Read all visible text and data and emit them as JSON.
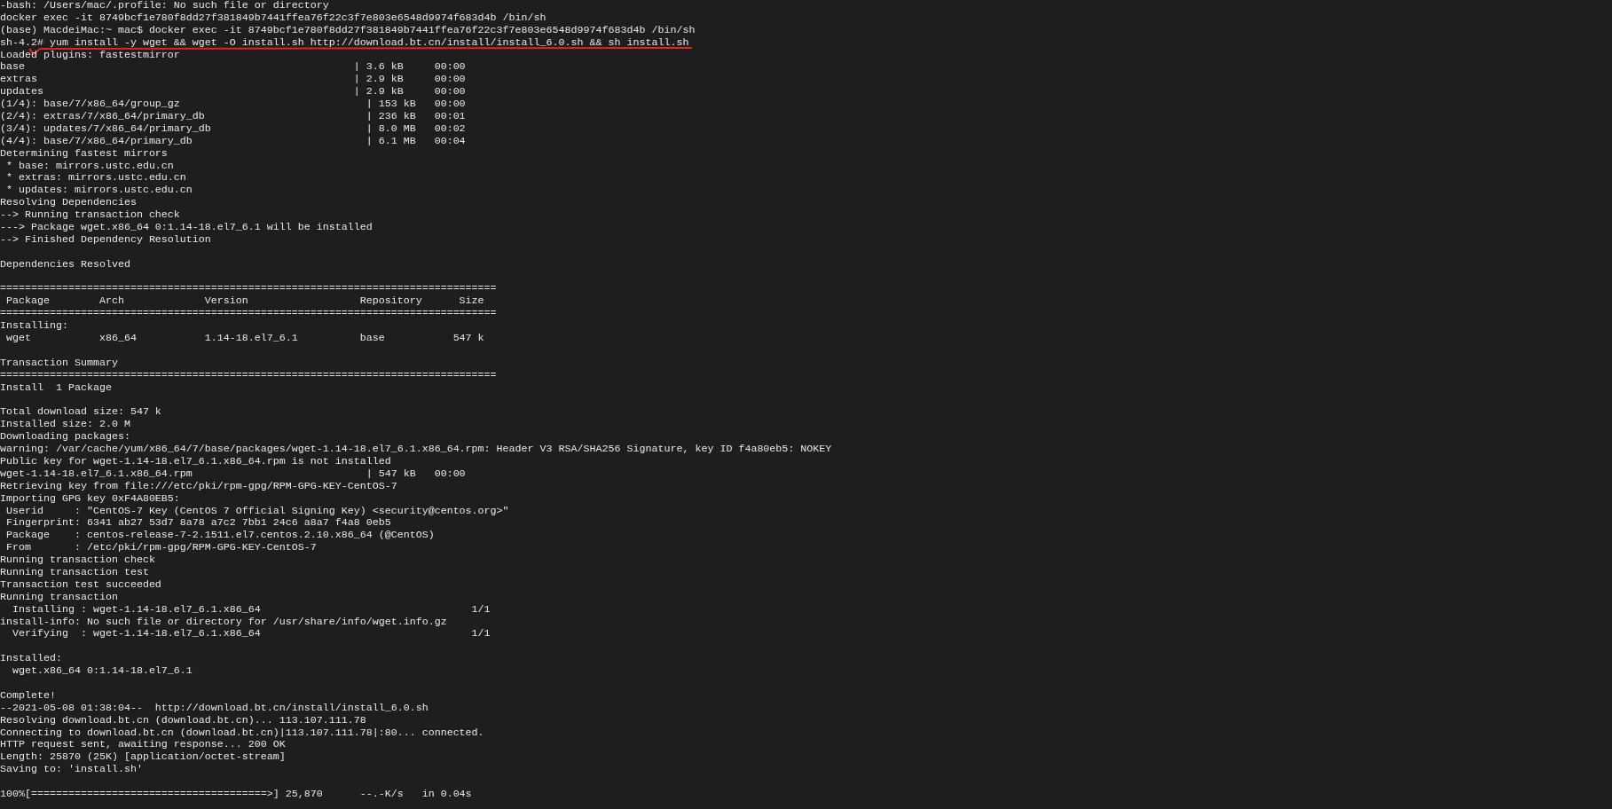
{
  "terminal": {
    "lines": [
      {
        "kind": "text",
        "text": "-bash: /Users/mac/.profile: No such file or directory"
      },
      {
        "kind": "text",
        "text": "docker exec -it 8749bcf1e780f8dd27f381849b7441ffea76f22c3f7e803e6548d9974f683d4b /bin/sh"
      },
      {
        "kind": "text",
        "text": "(base) MacdeiMac:~ mac$ docker exec -it 8749bcf1e780f8dd27f381849b7441ffea76f22c3f7e803e6548d9974f683d4b /bin/sh"
      },
      {
        "kind": "underlined",
        "text": "sh-4.2# yum install -y wget && wget -O install.sh http://download.bt.cn/install/install_6.0.sh && sh install.sh"
      },
      {
        "kind": "text",
        "text": "Loaded plugins: fastestmirror"
      },
      {
        "kind": "text",
        "text": "base                                                     | 3.6 kB     00:00"
      },
      {
        "kind": "text",
        "text": "extras                                                   | 2.9 kB     00:00"
      },
      {
        "kind": "text",
        "text": "updates                                                  | 2.9 kB     00:00"
      },
      {
        "kind": "text",
        "text": "(1/4): base/7/x86_64/group_gz                              | 153 kB   00:00"
      },
      {
        "kind": "text",
        "text": "(2/4): extras/7/x86_64/primary_db                          | 236 kB   00:01"
      },
      {
        "kind": "text",
        "text": "(3/4): updates/7/x86_64/primary_db                         | 8.0 MB   00:02"
      },
      {
        "kind": "text",
        "text": "(4/4): base/7/x86_64/primary_db                            | 6.1 MB   00:04"
      },
      {
        "kind": "text",
        "text": "Determining fastest mirrors"
      },
      {
        "kind": "text",
        "text": " * base: mirrors.ustc.edu.cn"
      },
      {
        "kind": "text",
        "text": " * extras: mirrors.ustc.edu.cn"
      },
      {
        "kind": "text",
        "text": " * updates: mirrors.ustc.edu.cn"
      },
      {
        "kind": "text",
        "text": "Resolving Dependencies"
      },
      {
        "kind": "text",
        "text": "--> Running transaction check"
      },
      {
        "kind": "text",
        "text": "---> Package wget.x86_64 0:1.14-18.el7_6.1 will be installed"
      },
      {
        "kind": "text",
        "text": "--> Finished Dependency Resolution"
      },
      {
        "kind": "blank"
      },
      {
        "kind": "text",
        "text": "Dependencies Resolved"
      },
      {
        "kind": "blank"
      },
      {
        "kind": "text",
        "text": "================================================================================"
      },
      {
        "kind": "text",
        "text": " Package        Arch             Version                  Repository      Size"
      },
      {
        "kind": "text",
        "text": "================================================================================"
      },
      {
        "kind": "text",
        "text": "Installing:"
      },
      {
        "kind": "text",
        "text": " wget           x86_64           1.14-18.el7_6.1          base           547 k"
      },
      {
        "kind": "blank"
      },
      {
        "kind": "text",
        "text": "Transaction Summary"
      },
      {
        "kind": "text",
        "text": "================================================================================"
      },
      {
        "kind": "text",
        "text": "Install  1 Package"
      },
      {
        "kind": "blank"
      },
      {
        "kind": "text",
        "text": "Total download size: 547 k"
      },
      {
        "kind": "text",
        "text": "Installed size: 2.0 M"
      },
      {
        "kind": "text",
        "text": "Downloading packages:"
      },
      {
        "kind": "text",
        "text": "warning: /var/cache/yum/x86_64/7/base/packages/wget-1.14-18.el7_6.1.x86_64.rpm: Header V3 RSA/SHA256 Signature, key ID f4a80eb5: NOKEY"
      },
      {
        "kind": "text",
        "text": "Public key for wget-1.14-18.el7_6.1.x86_64.rpm is not installed"
      },
      {
        "kind": "text",
        "text": "wget-1.14-18.el7_6.1.x86_64.rpm                            | 547 kB   00:00"
      },
      {
        "kind": "text",
        "text": "Retrieving key from file:///etc/pki/rpm-gpg/RPM-GPG-KEY-CentOS-7"
      },
      {
        "kind": "text",
        "text": "Importing GPG key 0xF4A80EB5:"
      },
      {
        "kind": "text",
        "text": " Userid     : \"CentOS-7 Key (CentOS 7 Official Signing Key) <security@centos.org>\""
      },
      {
        "kind": "text",
        "text": " Fingerprint: 6341 ab27 53d7 8a78 a7c2 7bb1 24c6 a8a7 f4a8 0eb5"
      },
      {
        "kind": "text",
        "text": " Package    : centos-release-7-2.1511.el7.centos.2.10.x86_64 (@CentOS)"
      },
      {
        "kind": "text",
        "text": " From       : /etc/pki/rpm-gpg/RPM-GPG-KEY-CentOS-7"
      },
      {
        "kind": "text",
        "text": "Running transaction check"
      },
      {
        "kind": "text",
        "text": "Running transaction test"
      },
      {
        "kind": "text",
        "text": "Transaction test succeeded"
      },
      {
        "kind": "text",
        "text": "Running transaction"
      },
      {
        "kind": "text",
        "text": "  Installing : wget-1.14-18.el7_6.1.x86_64                                  1/1"
      },
      {
        "kind": "text",
        "text": "install-info: No such file or directory for /usr/share/info/wget.info.gz"
      },
      {
        "kind": "text",
        "text": "  Verifying  : wget-1.14-18.el7_6.1.x86_64                                  1/1"
      },
      {
        "kind": "blank"
      },
      {
        "kind": "text",
        "text": "Installed:"
      },
      {
        "kind": "text",
        "text": "  wget.x86_64 0:1.14-18.el7_6.1"
      },
      {
        "kind": "blank"
      },
      {
        "kind": "text",
        "text": "Complete!"
      },
      {
        "kind": "text",
        "text": "--2021-05-08 01:38:04--  http://download.bt.cn/install/install_6.0.sh"
      },
      {
        "kind": "text",
        "text": "Resolving download.bt.cn (download.bt.cn)... 113.107.111.78"
      },
      {
        "kind": "text",
        "text": "Connecting to download.bt.cn (download.bt.cn)|113.107.111.78|:80... connected."
      },
      {
        "kind": "text",
        "text": "HTTP request sent, awaiting response... 200 OK"
      },
      {
        "kind": "text",
        "text": "Length: 25870 (25K) [application/octet-stream]"
      },
      {
        "kind": "text",
        "text": "Saving to: 'install.sh'"
      },
      {
        "kind": "blank"
      },
      {
        "kind": "text",
        "text": "100%[======================================>] 25,870      --.-K/s   in 0.04s"
      }
    ]
  }
}
